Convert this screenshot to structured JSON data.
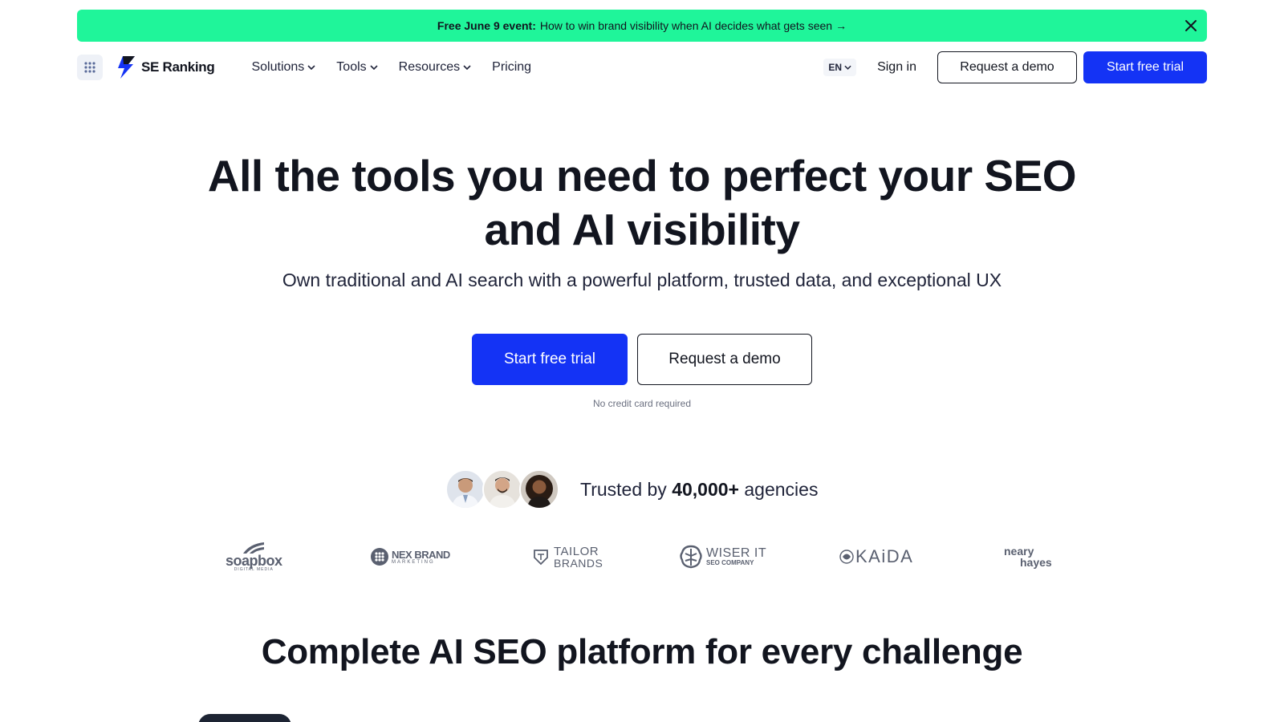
{
  "promo": {
    "strong": "Free June 9 event:",
    "text": "How to win brand visibility when AI decides what gets seen",
    "arrow": "→"
  },
  "header": {
    "logo_text": "SE Ranking",
    "nav": [
      {
        "label": "Solutions",
        "has_dropdown": true
      },
      {
        "label": "Tools",
        "has_dropdown": true
      },
      {
        "label": "Resources",
        "has_dropdown": true
      },
      {
        "label": "Pricing",
        "has_dropdown": false
      }
    ],
    "lang": "EN",
    "signin": "Sign in",
    "request_demo": "Request a demo",
    "start_trial": "Start free trial"
  },
  "hero": {
    "title_line1": "All the tools you need to perfect your SEO",
    "title_line2": "and AI visibility",
    "subtitle": "Own traditional and AI search with a powerful platform, trusted data, and exceptional UX",
    "cta_primary": "Start free trial",
    "cta_secondary": "Request a demo",
    "note": "No credit card required"
  },
  "trusted": {
    "prefix": "Trusted by",
    "count": "40,000+",
    "suffix": "agencies"
  },
  "brands": [
    {
      "name": "soapbox",
      "sub": "DIGITAL MEDIA"
    },
    {
      "name": "NEX BRAND",
      "sub": "MARKETING"
    },
    {
      "name": "TAILOR",
      "sub": "BRANDS"
    },
    {
      "name": "WISER IT",
      "sub": "SEO COMPANY"
    },
    {
      "name": "KAiDA",
      "sub": ""
    },
    {
      "name": "neary",
      "sub": "hayes"
    }
  ],
  "section": {
    "title": "Complete AI SEO platform for every challenge"
  },
  "colors": {
    "promo_bg": "#1ff59a",
    "primary": "#1433f5",
    "text_dark": "#12151f"
  }
}
